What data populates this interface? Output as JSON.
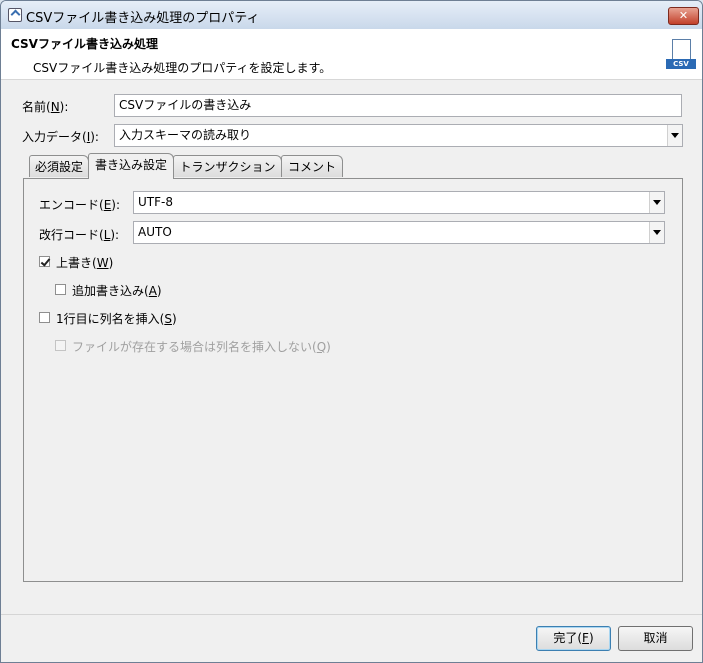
{
  "window": {
    "title": "CSVファイル書き込み処理のプロパティ",
    "close_label": "✕"
  },
  "header": {
    "title": "CSVファイル書き込み処理",
    "description": "CSVファイル書き込み処理のプロパティを設定します。",
    "icon_label": "CSV"
  },
  "form": {
    "name_label": "名前(",
    "name_mnemonic": "N",
    "name_label_end": "):",
    "name_value": "CSVファイルの書き込み",
    "input_label": "入力データ(",
    "input_mnemonic": "I",
    "input_label_end": "):",
    "input_value": "入力スキーマの読み取り"
  },
  "tabs": [
    {
      "label": "必須設定"
    },
    {
      "label": "書き込み設定"
    },
    {
      "label": "トランザクション"
    },
    {
      "label": "コメント"
    }
  ],
  "write_settings": {
    "encoding_label": "エンコード(",
    "encoding_mnemonic": "E",
    "encoding_label_end": "):",
    "encoding_value": "UTF-8",
    "newline_label": "改行コード(",
    "newline_mnemonic": "L",
    "newline_label_end": "):",
    "newline_value": "AUTO",
    "overwrite_label": "上書き(",
    "overwrite_mnemonic": "W",
    "overwrite_label_end": ")",
    "append_label": "追加書き込み(",
    "append_mnemonic": "A",
    "append_label_end": ")",
    "header_row_label": "1行目に列名を挿入(",
    "header_row_mnemonic": "S",
    "header_row_label_end": ")",
    "skip_if_exists_label": "ファイルが存在する場合は列名を挿入しない(",
    "skip_if_exists_mnemonic": "Q",
    "skip_if_exists_label_end": ")"
  },
  "checkbox_states": {
    "overwrite": true,
    "append": false,
    "header_row": false,
    "skip_if_exists": false
  },
  "buttons": {
    "finish_label": "完了(",
    "finish_mnemonic": "F",
    "finish_label_end": ")",
    "cancel_label": "取消"
  }
}
